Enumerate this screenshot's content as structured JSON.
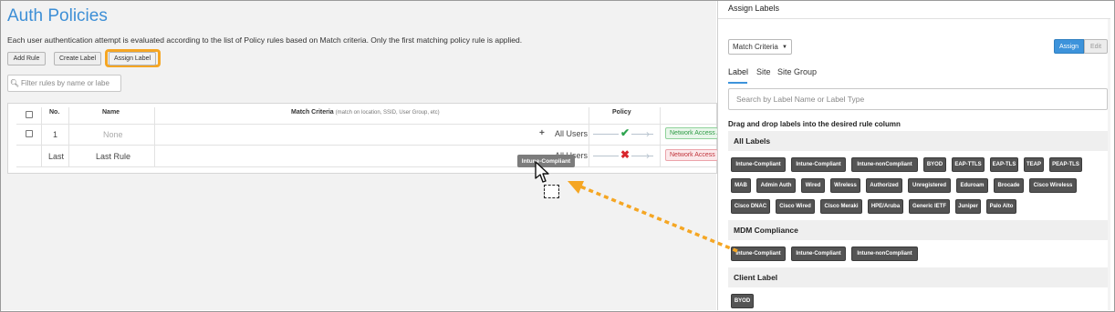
{
  "main": {
    "title": "Auth Policies",
    "description": "Each user authentication attempt is evaluated according to the list of Policy rules based on Match criteria. Only the first matching policy rule is applied.",
    "buttons": {
      "add_rule": "Add Rule",
      "create_label": "Create Label",
      "assign_label": "Assign Label"
    },
    "filter_placeholder": "Filter rules by name or labe",
    "table": {
      "headers": {
        "no": "No.",
        "name": "Name",
        "match": "Match Criteria",
        "match_sub": "(match on location, SSID, User Group, etc)",
        "policy": "Policy"
      },
      "rows": [
        {
          "no": "1",
          "name": "None",
          "match": "All Users",
          "policy": "allow",
          "result": "Network Access Al"
        },
        {
          "no": "Last",
          "name": "Last Rule",
          "match": "All Users",
          "policy": "deny",
          "result": "Network Access De"
        }
      ]
    },
    "drag_ghost": "Intune-Compliant"
  },
  "panel": {
    "title": "Assign Labels",
    "select_value": "Match Criteria",
    "assign_button": "Assign",
    "edit_button": "Edit",
    "tabs": [
      "Label",
      "Site",
      "Site Group"
    ],
    "search_placeholder": "Search by Label Name or Label Type",
    "drag_note": "Drag and drop labels into the desired rule column",
    "groups": [
      {
        "name": "All Labels",
        "rows": [
          [
            "Intune-Compliant",
            "Intune-Compliant",
            "Intune-nonCompliant",
            "BYOD",
            "EAP-TTLS",
            "EAP-TLS",
            "TEAP",
            "PEAP-TLS"
          ],
          [
            "MAB",
            "Admin Auth",
            "Wired",
            "Wireless",
            "Authorized",
            "Unregistered",
            "Eduroam",
            "Brocade",
            "Cisco Wireless"
          ],
          [
            "Cisco DNAC",
            "Cisco Wired",
            "Cisco Meraki",
            "HPE/Aruba",
            "Generic IETF",
            "Juniper",
            "Palo Alto"
          ]
        ]
      },
      {
        "name": "MDM Compliance",
        "rows": [
          [
            "Intune-Compliant",
            "Intune-Compliant",
            "Intune-nonCompliant"
          ]
        ]
      },
      {
        "name": "Client Label",
        "rows": [
          [
            "BYOD"
          ]
        ]
      }
    ]
  },
  "colors": {
    "accent": "#3d93db",
    "highlight": "#f5a623",
    "allow": "#2ea44f",
    "deny": "#d8262c"
  },
  "icons": [
    "search-icon",
    "check-icon",
    "cross-icon",
    "plus-icon",
    "caret-down-icon",
    "cursor-icon",
    "drop-target-icon"
  ]
}
